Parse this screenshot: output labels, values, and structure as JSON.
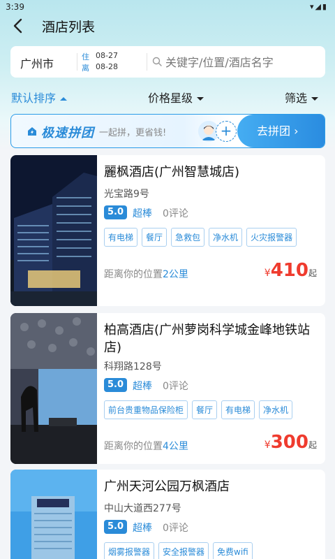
{
  "status": {
    "time": "3:39",
    "icons": "▾◢▮"
  },
  "nav": {
    "title": "酒店列表"
  },
  "search": {
    "city": "广州市",
    "checkin_label": "住",
    "checkout_label": "离",
    "checkin_date": "08-27",
    "checkout_date": "08-28",
    "placeholder": "关键字/位置/酒店名字"
  },
  "sort": {
    "default": "默认排序",
    "price_star": "价格星级",
    "filter": "筛选"
  },
  "promo": {
    "logo": "极速拼团",
    "slogan": "一起拼，更省钱!",
    "plus": "+",
    "button": "去拼团 ›"
  },
  "hotels": [
    {
      "name": "麗枫酒店(广州智慧城店)",
      "address": "光宝路9号",
      "score": "5.0",
      "rating": "超棒",
      "reviews": "0评论",
      "tags": [
        "有电梯",
        "餐厅",
        "急救包",
        "净水机",
        "火灾报警器"
      ],
      "distance_prefix": "距离你的位置",
      "distance": "2公里",
      "currency": "¥",
      "price": "410",
      "price_suffix": "起"
    },
    {
      "name": "柏高酒店(广州萝岗科学城金峰地铁站店)",
      "address": "科翔路128号",
      "score": "5.0",
      "rating": "超棒",
      "reviews": "0评论",
      "tags": [
        "前台贵重物品保险柜",
        "餐厅",
        "有电梯",
        "净水机"
      ],
      "distance_prefix": "距离你的位置",
      "distance": "4公里",
      "currency": "¥",
      "price": "300",
      "price_suffix": "起"
    },
    {
      "name": "广州天河公园万枫酒店",
      "address": "中山大道西277号",
      "score": "5.0",
      "rating": "超棒",
      "reviews": "0评论",
      "tags": [
        "烟雾报警器",
        "安全报警器",
        "免费wifi"
      ]
    }
  ]
}
